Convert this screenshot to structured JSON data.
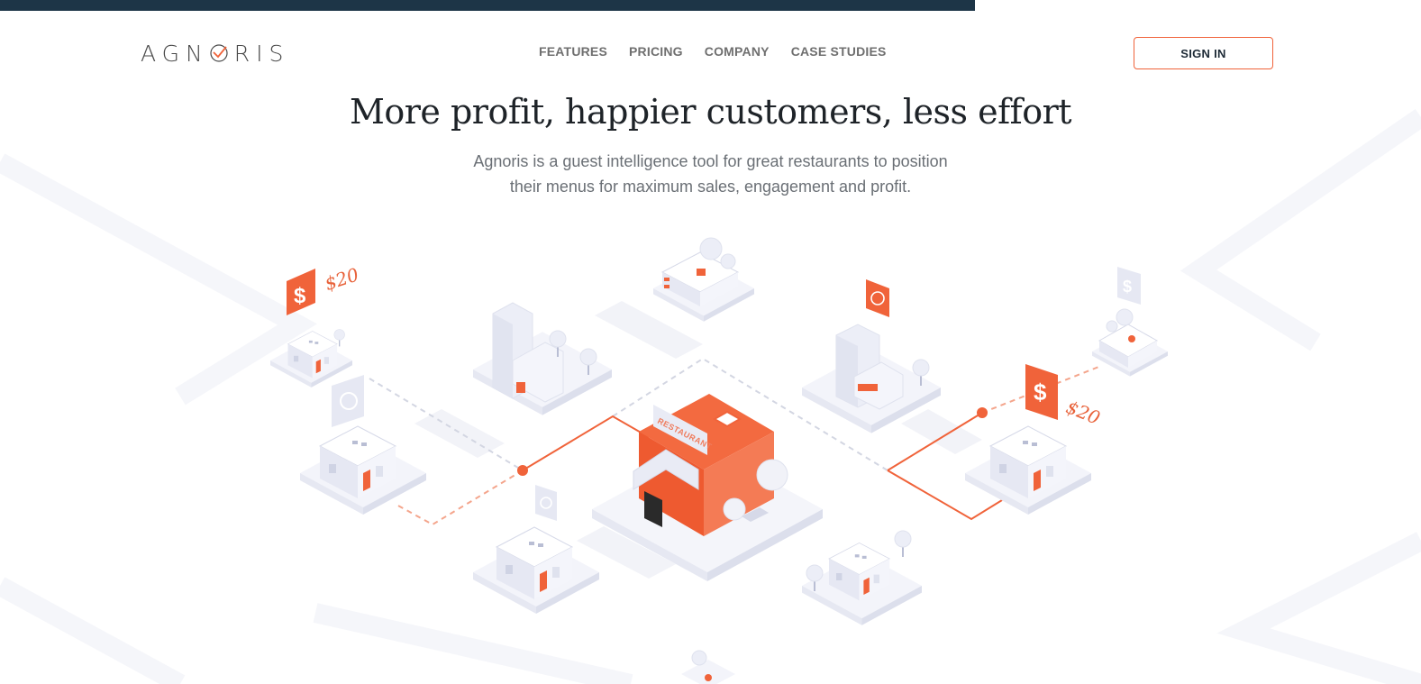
{
  "header": {
    "logo_text": "AGNORIS",
    "nav": [
      {
        "label": "FEATURES"
      },
      {
        "label": "PRICING"
      },
      {
        "label": "COMPANY"
      },
      {
        "label": "CASE STUDIES"
      }
    ],
    "signin_label": "SIGN IN"
  },
  "hero": {
    "headline": "More profit, happier customers, less effort",
    "subtitle_line1": "Agnoris is a guest intelligence tool for great restaurants to position",
    "subtitle_line2": "their menus for maximum sales, engagement and profit."
  },
  "illustration": {
    "price_left": "$20",
    "price_right": "$20",
    "restaurant_sign": "RESTAURANT",
    "dollar_symbol": "$"
  },
  "colors": {
    "accent": "#f0633a",
    "topbar": "#1d3547",
    "building": "#e9ebf5",
    "text_dark": "#1e2328",
    "text_muted": "#6a6f75"
  }
}
